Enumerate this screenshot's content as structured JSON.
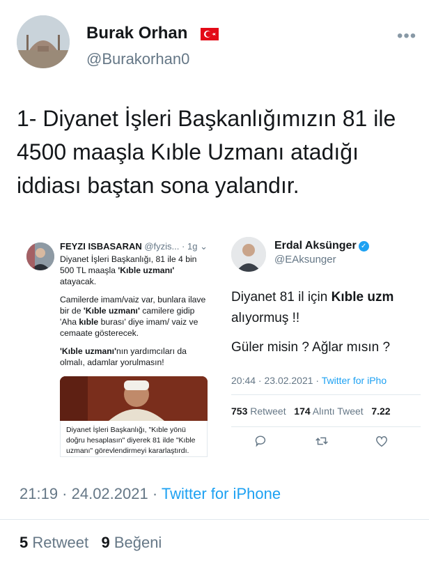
{
  "author": {
    "name": "Burak Orhan",
    "handle": "@Burakorhan0",
    "flag": "🇹🇷"
  },
  "more_menu": "•••",
  "tweet": {
    "text": "1- Diyanet İşleri Başkanlığımızın 81 ile 4500 maaşla Kıble Uzmanı atadığı iddiası baştan sona yalandır."
  },
  "embedded_left": {
    "name": "FEYZI ISBASARAN",
    "handle": "@fyzis...",
    "age": "· 1g",
    "menu": "⌄",
    "para1_pre": "Diyanet İşleri Başkanlığı, 81 ile 4 bin 500 TL maaşla ",
    "para1_bold": "'Kıble uzmanı'",
    "para1_post": " atayacak.",
    "para2_pre": "Camilerde imam/vaiz var, bunlara ilave bir de ",
    "para2_bold": "'Kıble uzmanı'",
    "para2_mid": " camilere gidip 'Aha ",
    "para2_bold2": "kıble",
    "para2_post": " burası' diye imam/ vaiz ve cemaate gösterecek.",
    "para3_bold": "'Kıble uzmanı'",
    "para3_post": "nın yardımcıları da olmalı, adamlar yorulmasın!",
    "caption": "Diyanet İşleri Başkanlığı, \"Kıble yönü doğru hesaplasın\" diyerek 81 ilde \"Kıble uzmanı\" görevlendirmeyi kararlaştırdı."
  },
  "embedded_right": {
    "name": "Erdal Aksünger",
    "verified": "✓",
    "handle": "@EAksunger",
    "line1_pre": "Diyanet 81 il için ",
    "line1_bold": "Kıble uzm",
    "line2": "alıyormuş !!",
    "line3": "Güler misin ? Ağlar mısın ?",
    "meta_time": "20:44 · 23.02.2021 · ",
    "meta_source": "Twitter for iPho",
    "retweets": "753",
    "retweets_label": "Retweet",
    "quotes": "174",
    "quotes_label": "Alıntı Tweet",
    "likes": "7.22"
  },
  "footer": {
    "time": "21:19 · 24.02.2021 · ",
    "source": "Twitter for iPhone",
    "retweets": "5",
    "retweets_label": "Retweet",
    "likes": "9",
    "likes_label": "Beğeni"
  }
}
